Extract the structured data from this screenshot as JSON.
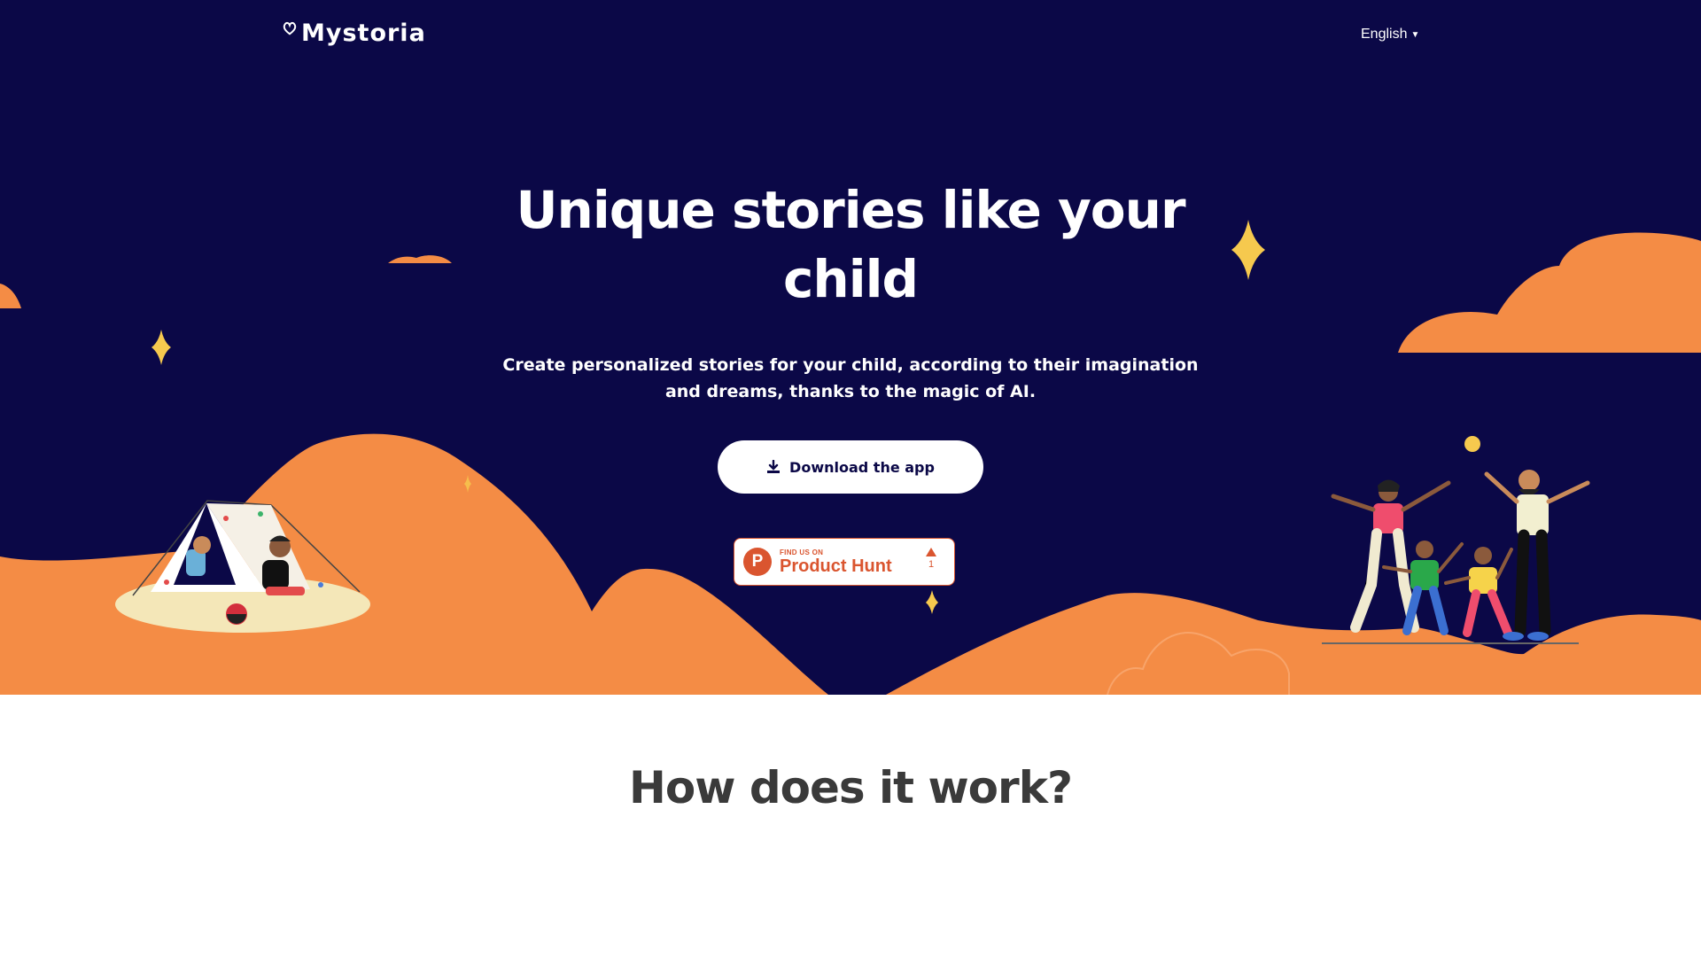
{
  "brand": {
    "name": "Mystoria"
  },
  "nav": {
    "language": "English"
  },
  "hero": {
    "title": "Unique stories like your child",
    "subtitle": "Create personalized stories for your child, according to their imagination and dreams, thanks to the magic of AI.",
    "download_label": "Download the app",
    "download_icon": "download-icon"
  },
  "product_hunt": {
    "find_text": "FIND US ON",
    "name": "Product Hunt",
    "logo_letter": "P",
    "votes": "1"
  },
  "section": {
    "how_title": "How does it work?"
  },
  "colors": {
    "hero_bg": "#0b0847",
    "hills": "#f48c45",
    "star": "#f6c94e",
    "white": "#ffffff",
    "heading_dark": "#3a3a3a",
    "product_hunt": "#da552f"
  }
}
